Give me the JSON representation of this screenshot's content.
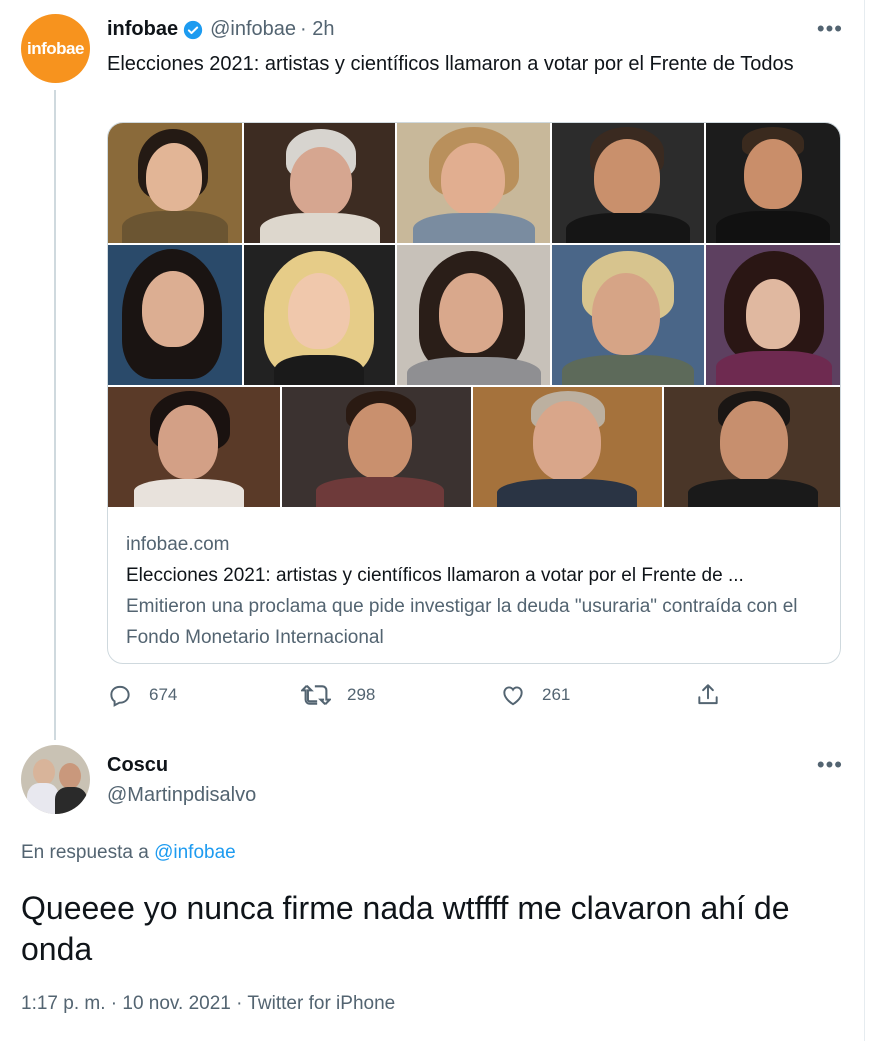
{
  "tweet1": {
    "avatar_text": "infobae",
    "name": "infobae",
    "handle": "@infobae",
    "time": "· 2h",
    "text": "Elecciones 2021: artistas y científicos llamaron a votar por el Frente de Todos",
    "more_icon": "more-icon",
    "card": {
      "domain": "infobae.com",
      "title": "Elecciones 2021: artistas y científicos llamaron a votar por el Frente de ...",
      "description": "Emitieron una proclama que pide investigar la deuda \"usuraria\" contraída con el Fondo Monetario Internacional"
    },
    "actions": {
      "replies": "674",
      "retweets": "298",
      "likes": "261"
    }
  },
  "tweet2": {
    "name": "Coscu",
    "handle": "@Martinpdisalvo",
    "reply_prefix": "En respuesta a",
    "reply_to": "@infobae",
    "text": "Queeee yo nunca firme nada wtffff me clavaron ahí de onda",
    "meta": "1:17 p. m. · 10 nov. 2021 · Twitter for iPhone"
  },
  "colors": {
    "accent": "#1d9bf0",
    "brand_infobae": "#f7931e",
    "secondary_text": "#536471"
  }
}
